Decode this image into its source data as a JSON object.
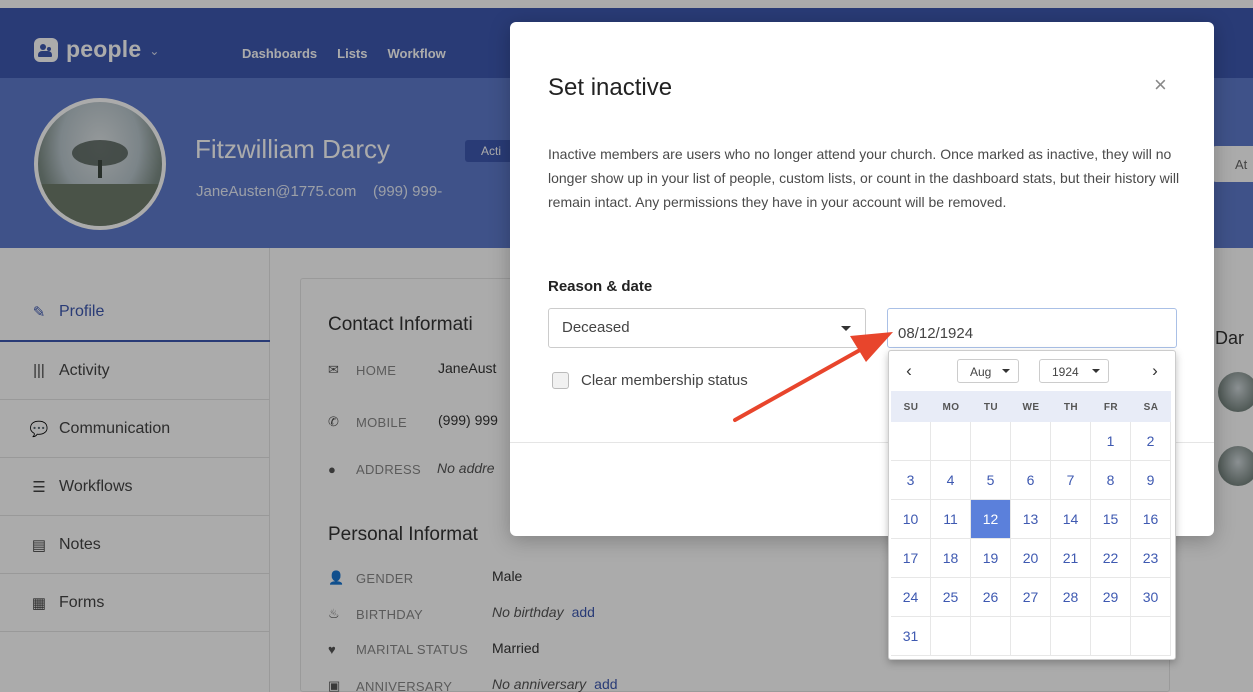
{
  "app": {
    "brand": "people",
    "nav": [
      "Dashboards",
      "Lists",
      "Workflow"
    ]
  },
  "profile": {
    "name": "Fitzwilliam Darcy",
    "status": "Acti",
    "email": "JaneAusten@1775.com",
    "phone": "(999) 999-",
    "right_button": "At"
  },
  "sidebar": {
    "items": [
      {
        "label": "Profile",
        "icon": "pencil-icon"
      },
      {
        "label": "Activity",
        "icon": "bars-icon"
      },
      {
        "label": "Communication",
        "icon": "chat-icon"
      },
      {
        "label": "Workflows",
        "icon": "list-icon"
      },
      {
        "label": "Notes",
        "icon": "note-icon"
      },
      {
        "label": "Forms",
        "icon": "form-icon"
      }
    ]
  },
  "contact": {
    "title": "Contact Informati",
    "home_label": "HOME",
    "home_value": "JaneAust",
    "mobile_label": "MOBILE",
    "mobile_value": "(999) 999",
    "address_label": "ADDRESS",
    "address_value": "No addre"
  },
  "personal": {
    "title": "Personal Informat",
    "gender_label": "GENDER",
    "gender_value": "Male",
    "birthday_label": "BIRTHDAY",
    "birthday_value": "No birthday",
    "birthday_link": "add",
    "marital_label": "MARITAL STATUS",
    "marital_value": "Married",
    "anniversary_label": "ANNIVERSARY",
    "anniversary_value": "No anniversary",
    "anniversary_link": "add"
  },
  "right_panel": {
    "name_partial": "Dar"
  },
  "modal": {
    "title": "Set inactive",
    "close": "×",
    "description": "Inactive members are users who no longer attend your church. Once marked as inactive, they will no longer show up in your list of people, custom lists, or count in the dashboard stats, but their history will remain intact. Any permissions they have in your account will be removed.",
    "reason_label": "Reason & date",
    "reason_value": "Deceased",
    "date_value": "08/12/1924",
    "checkbox_label": "Clear membership status"
  },
  "datepicker": {
    "prev": "‹",
    "next": "›",
    "month": "Aug",
    "year": "1924",
    "weekdays": [
      "SU",
      "MO",
      "TU",
      "WE",
      "TH",
      "FR",
      "SA"
    ],
    "first_weekday_index": 5,
    "days_in_month": 31,
    "selected_day": 12
  },
  "colors": {
    "nav": "#3e59b1",
    "header": "#5e7bcd",
    "accent": "#3e59b1",
    "selected_day": "#5b80db",
    "arrow": "#e8452c"
  }
}
